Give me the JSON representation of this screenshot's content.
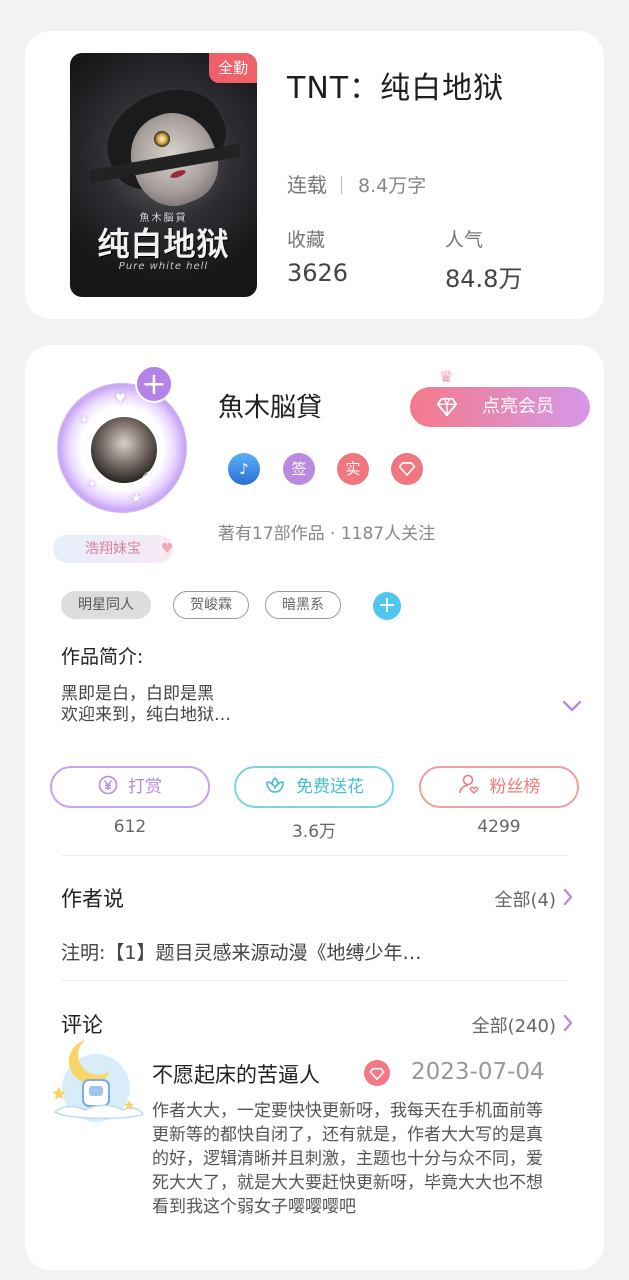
{
  "book": {
    "cover": {
      "badge": "全勤",
      "small_title": "魚木脳貸",
      "big_title": "纯白地狱",
      "en_title": "Pure white hell"
    },
    "title": "TNT：纯白地狱",
    "status": "连载",
    "word_count": "8.4万字",
    "collect_label": "收藏",
    "collect_value": "3626",
    "popularity_label": "人气",
    "popularity_value": "84.8万"
  },
  "author": {
    "name": "魚木脳貸",
    "fan_tag": "浩翔妹宝",
    "vip_button": "点亮会员",
    "badges": [
      {
        "icon": "music-note-badge-icon",
        "text": "",
        "color": "#3e8ee8"
      },
      {
        "icon": "sign-badge-icon",
        "text": "签",
        "color": "#b98ae0"
      },
      {
        "icon": "real-name-badge-icon",
        "text": "实",
        "color": "#f07780"
      },
      {
        "icon": "diamond-badge-icon",
        "text": "",
        "color": "#f07780"
      }
    ],
    "works_line": "著有17部作品 · 1187人关注"
  },
  "tags": [
    "明星同人",
    "贺峻霖",
    "暗黑系"
  ],
  "intro": {
    "heading": "作品简介:",
    "line1": "黑即是白，白即是黑",
    "line2": "欢迎来到，纯白地狱…"
  },
  "actions": [
    {
      "label": "打赏",
      "count": "612",
      "color": "#b78be2",
      "icon": "yen-icon"
    },
    {
      "label": "免费送花",
      "count": "3.6万",
      "color": "#4cc6d6",
      "icon": "flower-icon"
    },
    {
      "label": "粉丝榜",
      "count": "4299",
      "color": "#ee8080",
      "icon": "fans-icon"
    }
  ],
  "author_says": {
    "title": "作者说",
    "all": "全部(4)",
    "text": "注明:【1】题目灵感来源动漫《地缚少年…"
  },
  "comments": {
    "title": "评论",
    "all": "全部(240)",
    "item": {
      "user": "不愿起床的苦逼人",
      "date": "2023-07-04",
      "text": "作者大大，一定要快快更新呀，我每天在手机面前等更新等的都快自闭了，还有就是，作者大大写的是真的好，逻辑清晰并且刺激，主题也十分与众不同，爱死大大了，就是大大要赶快更新呀，毕竟大大也不想看到我这个弱女子嘤嘤嘤吧"
    }
  },
  "colors": {
    "accent_purple": "#b583e8",
    "accent_pink": "#f0606a",
    "accent_cyan": "#4fc7ee"
  }
}
